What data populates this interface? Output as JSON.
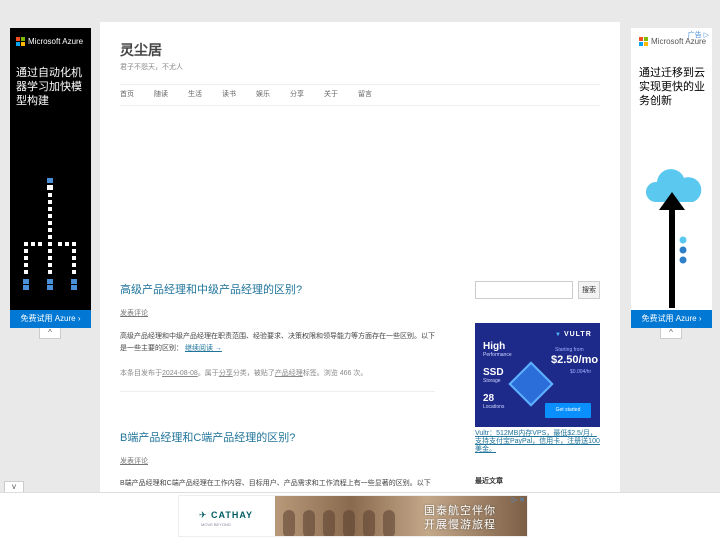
{
  "left_ad": {
    "brand": "Microsoft Azure",
    "copy": "通过自动化机器学习加快模型构建",
    "cta": "免费试用 Azure ›",
    "collapse": "^"
  },
  "right_ad": {
    "brand": "Microsoft Azure",
    "adchoice": "广告 ▷",
    "copy": "通过迁移到云实现更快的业务创新",
    "cta": "免费试用 Azure ›",
    "collapse": "^"
  },
  "site": {
    "title": "灵尘居",
    "description": "君子不怨天，不尤人"
  },
  "nav": [
    "首页",
    "随读",
    "生活",
    "读书",
    "娱乐",
    "分享",
    "关于",
    "留言"
  ],
  "posts": [
    {
      "title": "高级产品经理和中级产品经理的区别?",
      "comment": "发表评论",
      "excerpt": "高级产品经理和中级产品经理在职责范围、经验要求、决策权限和领导能力等方面存在一些区别。以下是一些主要的区别：",
      "read_more": "继续阅读 →",
      "meta_prefix": "本条目发布于",
      "date": "2024-08-08",
      "meta_mid": "。属于",
      "category": "分享",
      "meta_mid2": "分类，被贴了",
      "tag": "产品经理",
      "meta_suffix": "标签。浏览 466 次。"
    },
    {
      "title": "B端产品经理和C端产品经理的区别?",
      "comment": "发表评论",
      "excerpt": "B端产品经理和C端产品经理在工作内容、目标用户、产品需求和工作流程上有一些显著的区别。以下"
    }
  ],
  "sidebar": {
    "search_button": "搜索",
    "vultr": {
      "brand": "VULTR",
      "high": "High",
      "performance": "Performance",
      "ssd": "SSD",
      "storage": "Storage",
      "locations_count": "28",
      "locations": "Locations",
      "starting": "Starting from",
      "price": "$2.50/mo",
      "price_sub": "$0.004/hr",
      "button": "Get started"
    },
    "vultr_caption": "Vultr：512MB内存VPS，最低$2.5/月，支持支付宝PayPal，信用卡，注册送100美金。",
    "recent_title": "最近文章"
  },
  "bottom_ad": {
    "collapse": "v",
    "brand": "CATHAY",
    "brand_sub": "MOVE BEYOND",
    "copy_line1": "国泰航空伴你",
    "copy_line2": "开展慢游旅程",
    "adchoice": "▷ ✕"
  }
}
